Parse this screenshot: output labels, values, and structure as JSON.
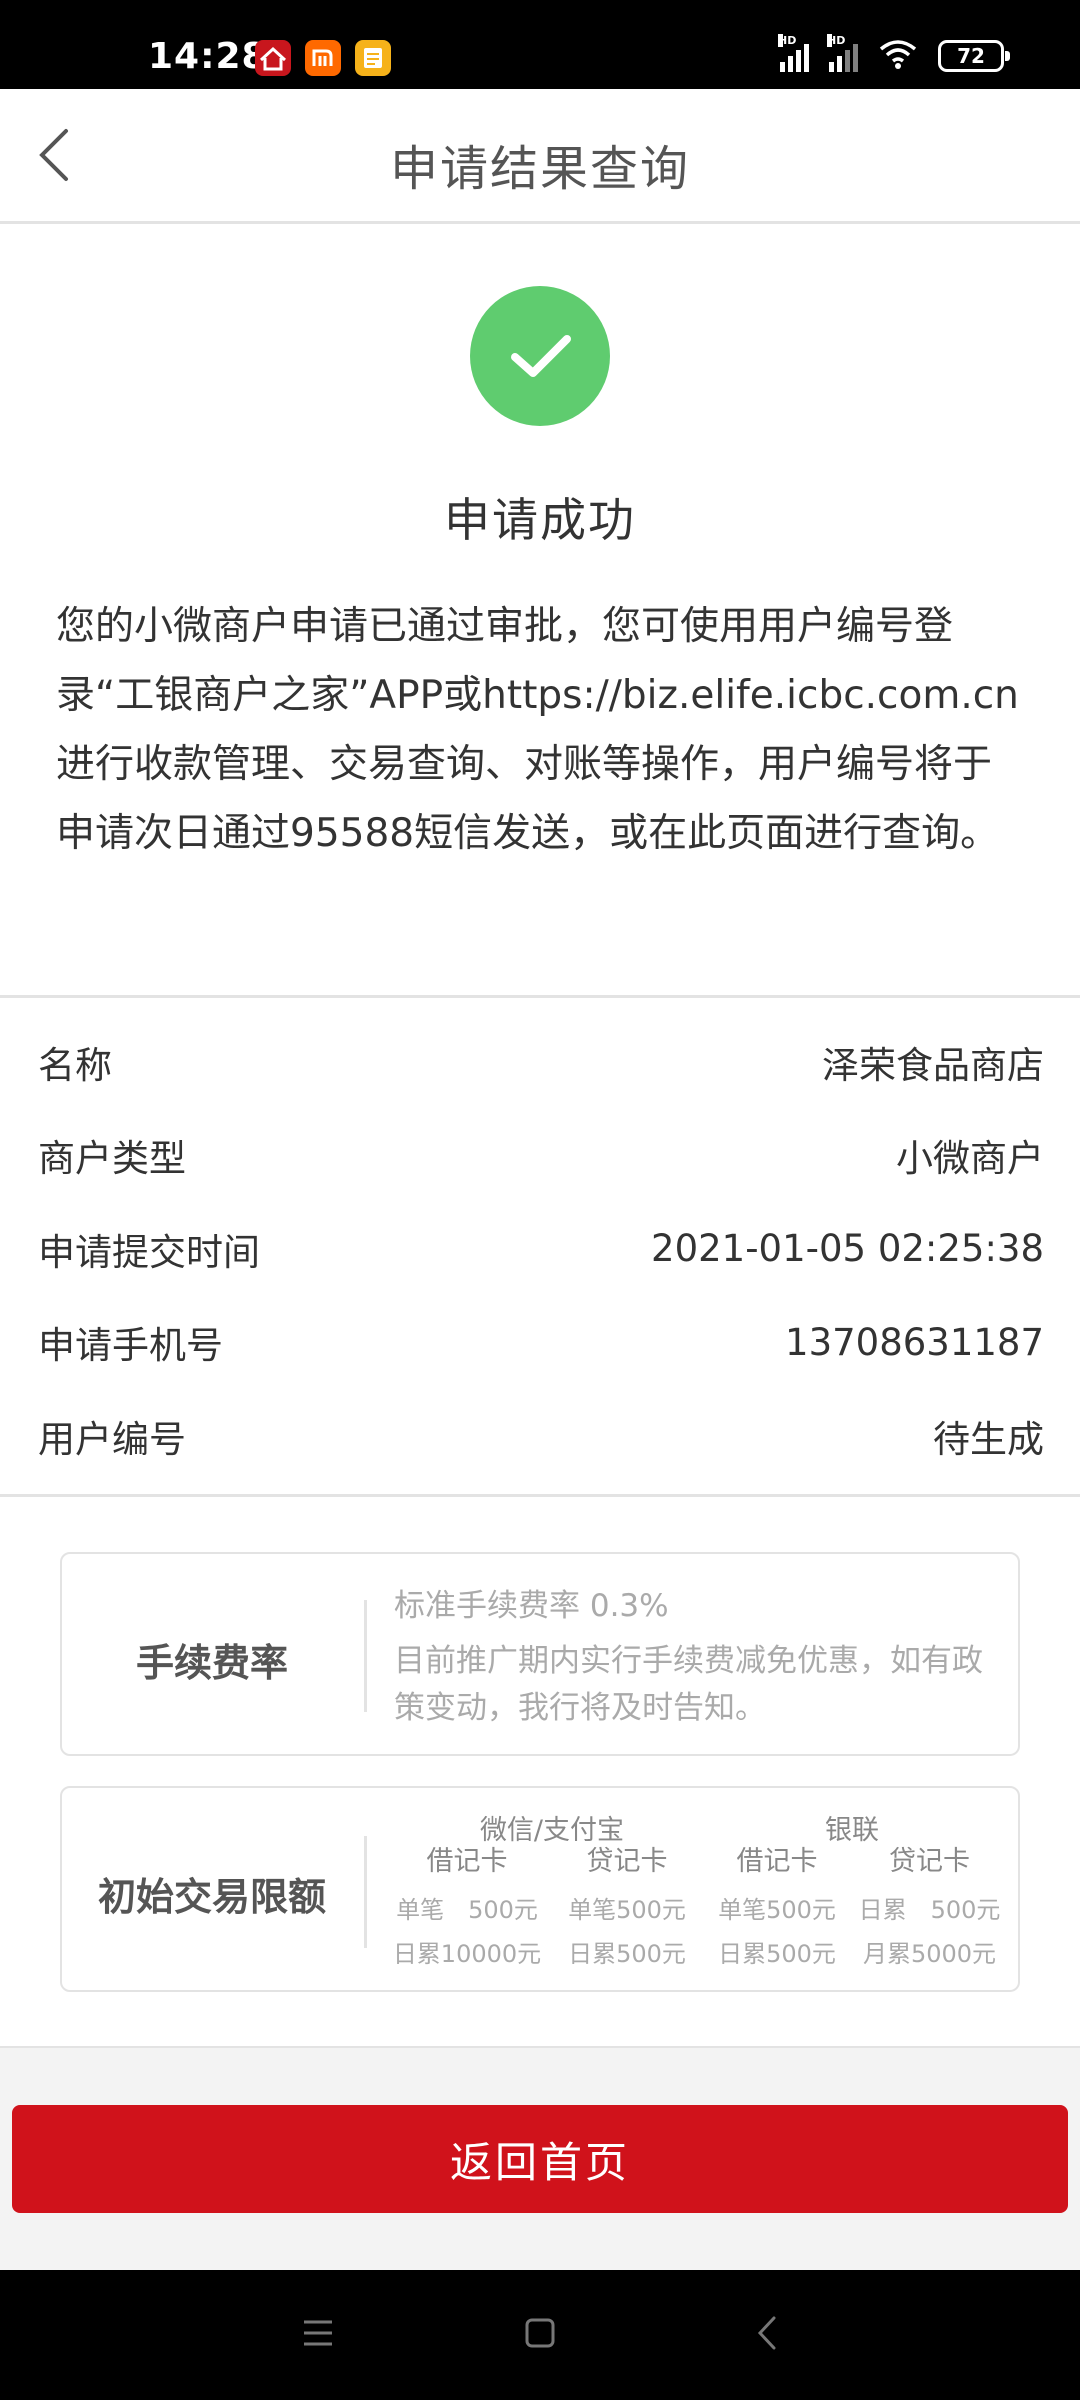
{
  "status_bar": {
    "time": "14:28",
    "battery": "72",
    "signal_tags": [
      "HD",
      "HD"
    ],
    "app_icons": [
      "house-app-icon",
      "mi-app-icon",
      "notes-app-icon"
    ]
  },
  "header": {
    "title": "申请结果查询"
  },
  "result": {
    "title": "申请成功",
    "description": "您的小微商户申请已通过审批，您可使用用户编号登录“工银商户之家”APP或https://biz.elife.icbc.com.cn进行收款管理、交易查询、对账等操作，用户编号将于申请次日通过95588短信发送，或在此页面进行查询。"
  },
  "info": [
    {
      "label": "名称",
      "value": "泽荣食品商店"
    },
    {
      "label": "商户类型",
      "value": "小微商户"
    },
    {
      "label": "申请提交时间",
      "value": "2021-01-05 02:25:38"
    },
    {
      "label": "申请手机号",
      "value": "13708631187"
    },
    {
      "label": "用户编号",
      "value": "待生成"
    }
  ],
  "fee": {
    "label": "手续费率",
    "rate": "标准手续费率 0.3%",
    "note": "目前推广期内实行手续费减免优惠，如有政策变动，我行将及时告知。"
  },
  "limits": {
    "label": "初始交易限额",
    "groups": [
      "微信/支付宝",
      "银联"
    ],
    "columns": [
      {
        "header": "借记卡",
        "single": "单笔　500元",
        "daily": "日累10000元"
      },
      {
        "header": "贷记卡",
        "single": "单笔500元",
        "daily": "日累500元"
      },
      {
        "header": "借记卡",
        "single": "单笔500元",
        "daily": "日累500元"
      },
      {
        "header": "贷记卡",
        "single": "日累　500元",
        "daily": "月累5000元"
      }
    ]
  },
  "actions": {
    "home_label": "返回首页"
  },
  "colors": {
    "brand_red": "#d0121b",
    "success_green": "#5fcc6f"
  }
}
